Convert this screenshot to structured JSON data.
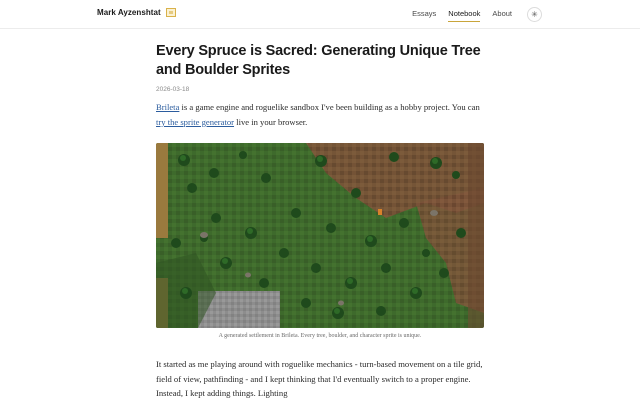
{
  "header": {
    "brand": "Mark Ayzenshtat",
    "nav": [
      {
        "label": "Essays",
        "active": false
      },
      {
        "label": "Notebook",
        "active": true
      },
      {
        "label": "About",
        "active": false
      }
    ],
    "theme_toggle_icon": "sun-icon"
  },
  "article": {
    "title": "Every Spruce is Sacred: Generating Unique Tree and Boulder Sprites",
    "date": "2026-03-18",
    "intro": {
      "link1": "Brileta",
      "text1": " is a game engine and roguelike sandbox I've been building as a hobby project. You can ",
      "link2": "try the sprite generator",
      "text2": " live in your browser."
    },
    "figure_caption": "A generated settlement in Brileta. Every tree, boulder, and character sprite is unique.",
    "paragraph": "It started as me playing around with roguelike mechanics - turn-based movement on a tile grid, field of view, pathfinding - and I kept thinking that I'd eventually switch to a proper engine. Instead, I kept adding things. Lighting"
  },
  "colors": {
    "accent": "#c9a53a",
    "link": "#2b5c9e"
  }
}
